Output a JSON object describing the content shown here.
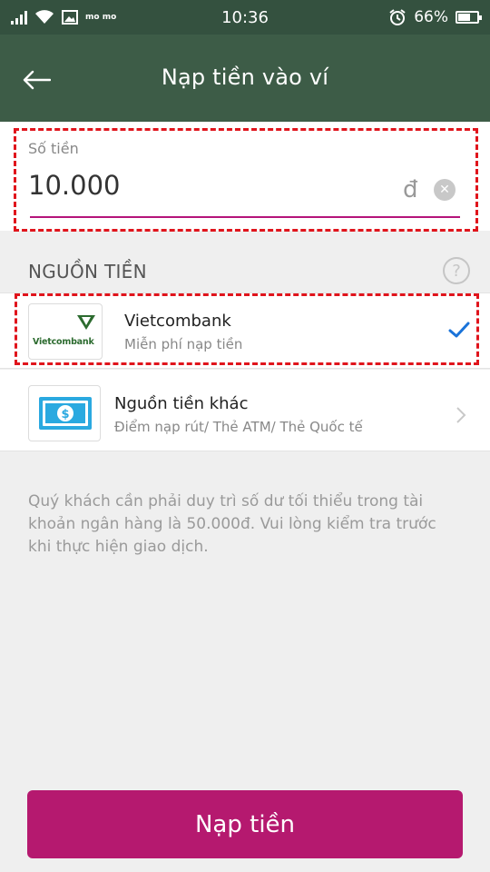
{
  "status_bar": {
    "carrier_logo": "mo mo",
    "time": "10:36",
    "battery": "66%",
    "battery_level": 0.66
  },
  "header": {
    "title": "Nạp tiền vào ví"
  },
  "amount": {
    "label": "Số tiền",
    "value": "10.000",
    "currency": "đ"
  },
  "sources": {
    "title": "NGUỒN TIỀN",
    "help": "?",
    "items": [
      {
        "name": "Vietcombank",
        "subtitle": "Miễn phí nạp tiền",
        "logo_text": "Vietcombank",
        "selected": true
      },
      {
        "name": "Nguồn tiền khác",
        "subtitle": "Điểm nạp rút/ Thẻ ATM/ Thẻ Quốc tế",
        "selected": false
      }
    ]
  },
  "notice": "Quý khách cần phải duy trì số dư tối thiểu trong tài khoản ngân hàng là 50.000đ. Vui lòng kiểm tra trước khi thực hiện giao dịch.",
  "submit": {
    "label": "Nạp tiền"
  },
  "colors": {
    "header_bg": "#3d5c47",
    "status_bg": "#34513f",
    "accent": "#b5196f",
    "highlight_dashed": "#e0141c",
    "check": "#1a73d9"
  }
}
